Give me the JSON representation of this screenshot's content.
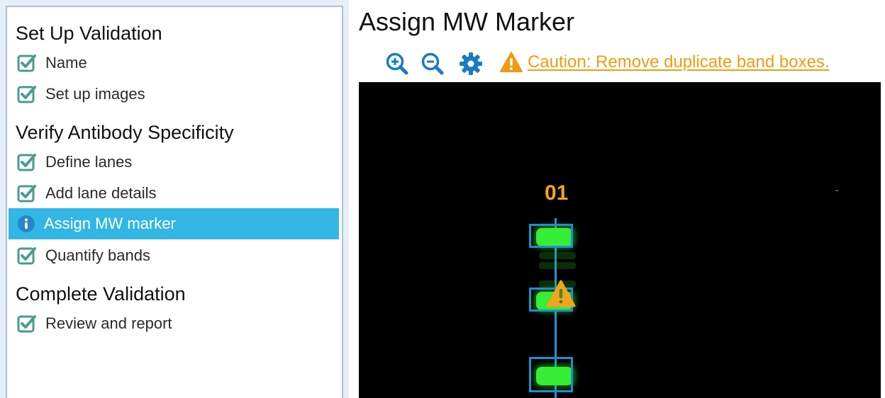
{
  "sidebar": {
    "sections": [
      {
        "title": "Set Up Validation",
        "steps": [
          {
            "label": "Name",
            "state": "complete"
          },
          {
            "label": "Set up images",
            "state": "complete"
          }
        ]
      },
      {
        "title": "Verify Antibody Specificity",
        "steps": [
          {
            "label": "Define lanes",
            "state": "complete"
          },
          {
            "label": "Add lane details",
            "state": "complete"
          },
          {
            "label": "Assign MW marker",
            "state": "current"
          },
          {
            "label": "Quantify bands",
            "state": "complete"
          }
        ]
      },
      {
        "title": "Complete Validation",
        "steps": [
          {
            "label": "Review and report",
            "state": "complete"
          }
        ]
      }
    ]
  },
  "main": {
    "title": "Assign MW Marker",
    "toolbar": {
      "icons": [
        "zoom-in-icon",
        "zoom-out-icon",
        "gear-icon",
        "warning-icon"
      ],
      "caution_text": "Caution: Remove duplicate band boxes."
    },
    "image": {
      "lane_label": "01"
    }
  },
  "colors": {
    "accent": "#32b6e4",
    "check": "#4a9b8e",
    "toolbar_icon": "#1a7bc4",
    "caution": "#f29b0f",
    "band": "#35ee35",
    "band_box": "#1c8fd4",
    "lane_label": "#f5a31a"
  }
}
